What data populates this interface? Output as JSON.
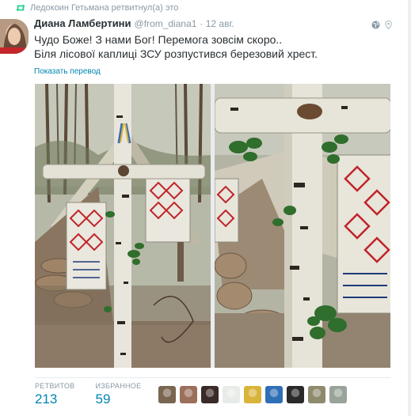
{
  "retweet_bar": {
    "text": "Ледокоин Гетьмана ретвитнул(а) это"
  },
  "tweet": {
    "name": "Диана Ламбертини",
    "handle": "@from_diana1",
    "date": "· 12 авг.",
    "lines": [
      "Чудо Боже! З нами Бог! Перемога зовсім скоро..",
      "Біля лісової каплиці ЗСУ розпустився березовий хрест."
    ],
    "translate_label": "Показать перевод"
  },
  "stats": {
    "retweets_label": "РЕТВИТОВ",
    "retweets_value": "213",
    "favorites_label": "ИЗБРАННОЕ",
    "favorites_value": "59"
  },
  "icons": {
    "retweet": "retweet-icon",
    "globe": "globe-icon",
    "location": "location-pin-icon"
  },
  "likers": [
    {
      "name": "liker-avatar-1",
      "color": "#7a6650"
    },
    {
      "name": "liker-avatar-2",
      "color": "#9b6f5a"
    },
    {
      "name": "liker-avatar-3",
      "color": "#3a2a28"
    },
    {
      "name": "liker-avatar-4",
      "color": "#e8ece8"
    },
    {
      "name": "liker-avatar-5",
      "color": "#d9b43a"
    },
    {
      "name": "liker-avatar-6",
      "color": "#2f6fb5"
    },
    {
      "name": "liker-avatar-7",
      "color": "#2a2a2a"
    },
    {
      "name": "liker-avatar-8",
      "color": "#8e8a6e"
    },
    {
      "name": "liker-avatar-9",
      "color": "#9aa39a"
    }
  ],
  "colors": {
    "accent": "#0084b4",
    "muted": "#8899a6",
    "retweet_green": "#19cf86"
  }
}
